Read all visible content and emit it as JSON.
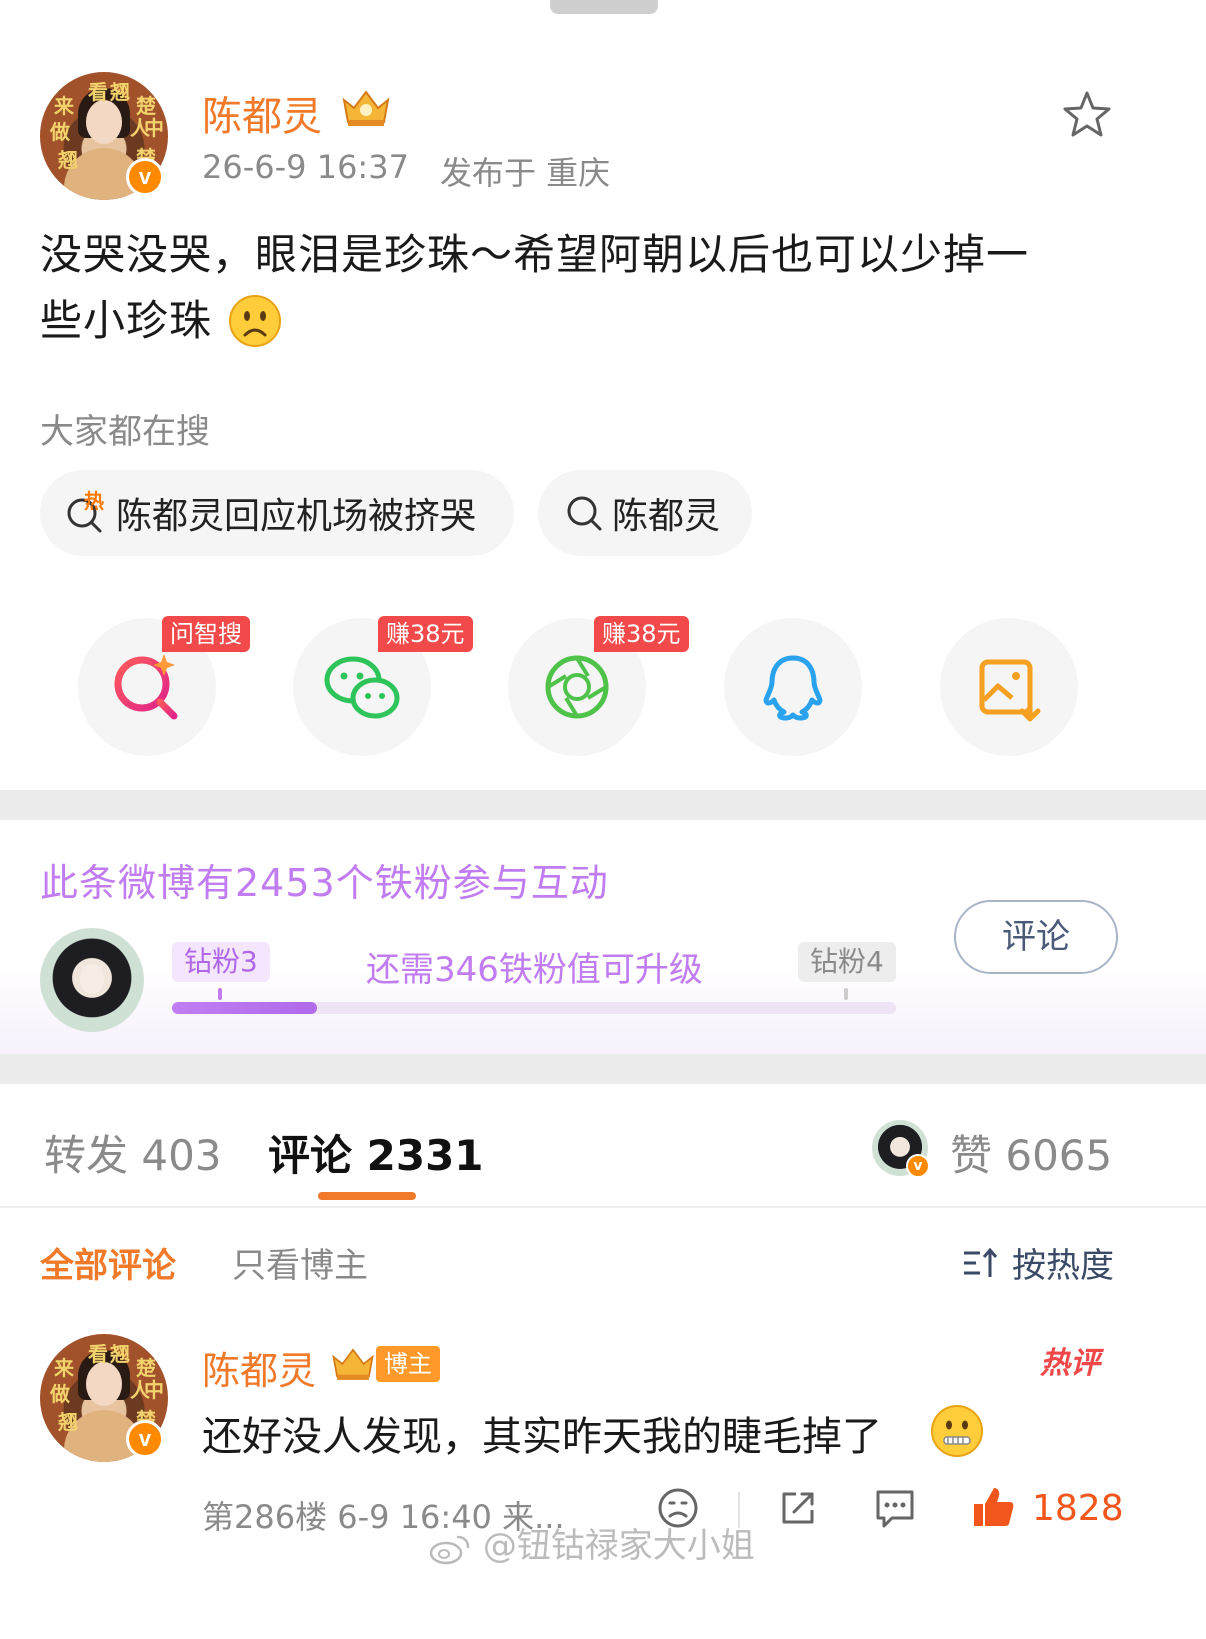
{
  "post": {
    "author": "陈都灵",
    "time": "26-6-9 16:37",
    "location": "发布于 重庆",
    "content_line1": "没哭没哭，眼泪是珍珠～希望阿朝以后也可以少掉一",
    "content_line2": "些小珍珠",
    "avatar_text": [
      "来",
      "看",
      "翘",
      "楚",
      "做",
      "人",
      "中",
      "翘",
      "楚"
    ]
  },
  "search": {
    "label": "大家都在搜",
    "pills": [
      {
        "text": "陈都灵回应机场被挤哭",
        "hot_mark": "热"
      },
      {
        "text": "陈都灵"
      }
    ]
  },
  "share": {
    "tags": [
      "问智搜",
      "赚38元",
      "赚38元"
    ],
    "icons": [
      "ai-search-icon",
      "wechat-icon",
      "moments-icon",
      "qq-icon",
      "save-image-icon"
    ]
  },
  "fans": {
    "title": "此条微博有2453个铁粉参与互动",
    "level_current": "钻粉3",
    "level_next": "钻粉4",
    "hint": "还需346铁粉值可升级",
    "progress": 0.2,
    "comment_button": "评论"
  },
  "tabs": {
    "repost": "转发 403",
    "comments": "评论 2331",
    "likes": "赞 6065"
  },
  "filters": {
    "all": "全部评论",
    "author_only": "只看博主",
    "sort": "按热度"
  },
  "comment": {
    "author": "陈都灵",
    "badge": "博主",
    "hot_badge": "热评",
    "text": "还好没人发现，其实昨天我的睫毛掉了",
    "meta": "第286楼 6-9 16:40 来...",
    "likes": "1828"
  },
  "watermark": "@钮钴禄家大小姐",
  "colors": {
    "accent_orange": "#f07a2a",
    "fan_purple": "#c07cf0",
    "tag_red": "#f24a4a"
  }
}
